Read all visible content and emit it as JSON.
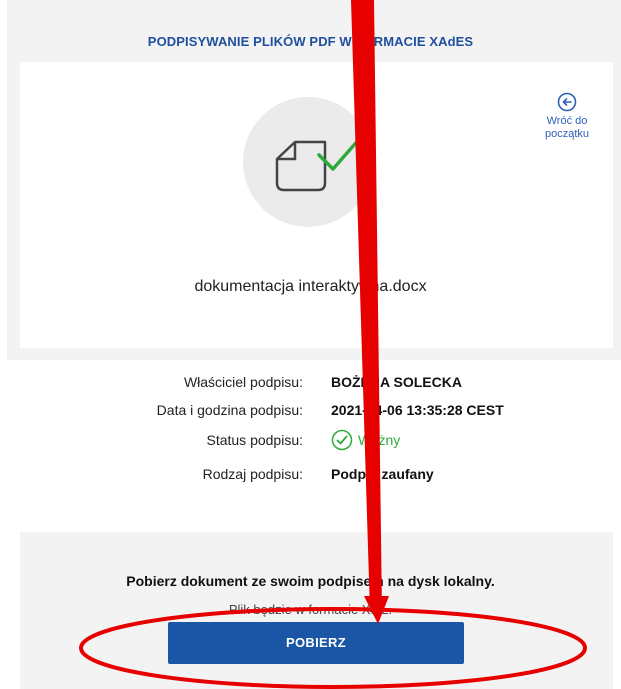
{
  "panel": {
    "title": "PODPISYWANIE PLIKÓW PDF W FORMACIE XAdES",
    "back_link_label": "Wróć do początku",
    "back_icon": "arrow-left-circle-icon",
    "document_icon": "signed-document-icon",
    "filename": "dokumentacja interaktywna.docx"
  },
  "signature_info": {
    "owner_label": "Właściciel podpisu:",
    "owner_value": "BOŻENA SOLECKA",
    "date_label": "Data i godzina podpisu:",
    "date_value": "2021-04-06 13:35:28 CEST",
    "status_label": "Status podpisu:",
    "status_value": "Ważny",
    "status_icon": "check-circle-icon",
    "type_label": "Rodzaj podpisu:",
    "type_value": "Podpis zaufany"
  },
  "download": {
    "heading": "Pobierz dokument ze swoim podpisem na dysk lokalny.",
    "subtext": "Plik będzie w formacie XML.",
    "button_label": "POBIERZ"
  },
  "colors": {
    "accent": "#1b55a5",
    "title": "#1f4f9e",
    "valid": "#2eaa3c",
    "annotation": "#e60000"
  }
}
